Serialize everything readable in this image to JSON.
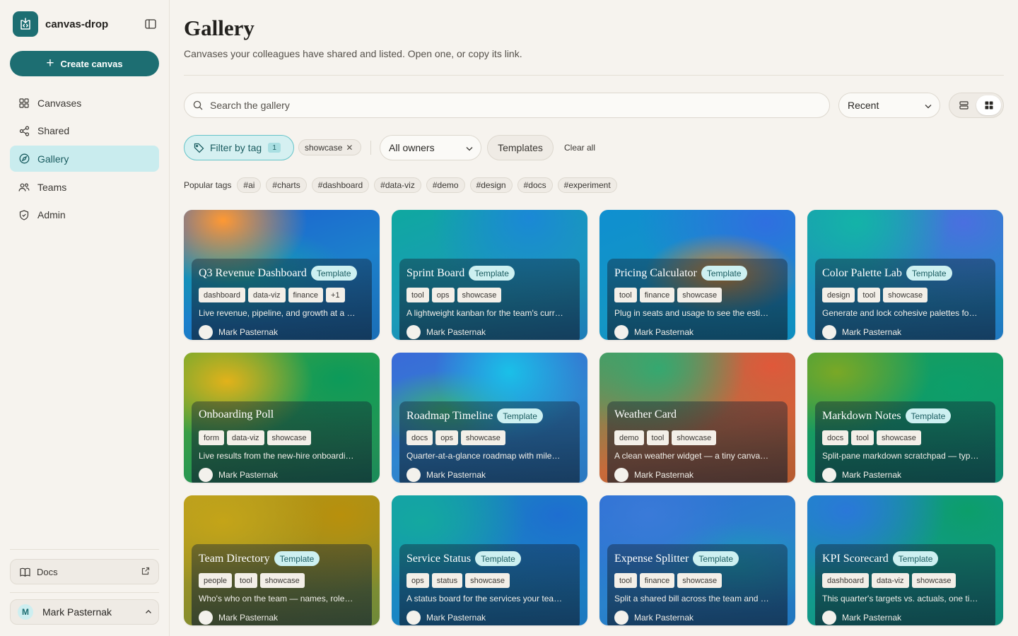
{
  "app": {
    "name": "canvas-drop"
  },
  "sidebar": {
    "create_label": "Create canvas",
    "items": [
      {
        "label": "Canvases",
        "icon": "grid-icon",
        "active": false
      },
      {
        "label": "Shared",
        "icon": "share-icon",
        "active": false
      },
      {
        "label": "Gallery",
        "icon": "compass-icon",
        "active": true
      },
      {
        "label": "Teams",
        "icon": "users-icon",
        "active": false
      },
      {
        "label": "Admin",
        "icon": "shield-icon",
        "active": false
      }
    ],
    "docs_label": "Docs",
    "user": {
      "initial": "M",
      "name": "Mark Pasternak"
    }
  },
  "page": {
    "title": "Gallery",
    "subtitle": "Canvases your colleagues have shared and listed. Open one, or copy its link."
  },
  "toolbar": {
    "search_placeholder": "Search the gallery",
    "sort_value": "Recent",
    "view_mode": "grid"
  },
  "filters": {
    "filter_by_tag_label": "Filter by tag",
    "filter_count": "1",
    "active_tag": "showcase",
    "owners_value": "All owners",
    "templates_label": "Templates",
    "clear_all_label": "Clear all"
  },
  "popular": {
    "label": "Popular tags",
    "tags": [
      "#ai",
      "#charts",
      "#dashboard",
      "#data-viz",
      "#demo",
      "#design",
      "#docs",
      "#experiment"
    ]
  },
  "colors": {
    "accent": "#1d6e72",
    "active_nav": "#c9ecee",
    "badge": "#cdf0f1"
  },
  "template_label": "Template",
  "cards": [
    {
      "title": "Q3 Revenue Dashboard",
      "template": true,
      "tags": [
        "dashboard",
        "data-viz",
        "finance",
        "+1"
      ],
      "desc": "Live revenue, pipeline, and growth at a glance for the quarter.",
      "owner": "Mark Pasternak",
      "bg": "radial-gradient(ellipse at 20% 8%, #ff9933 0%, rgba(255,153,51,0) 38%), radial-gradient(ellipse at 28% 50%, #11a8a8 0%, rgba(17,168,168,0) 55%), linear-gradient(160deg, #1d5fd0 0%, #1c80cc 55%, #1b6eb6 100%)"
    },
    {
      "title": "Sprint Board",
      "template": true,
      "tags": [
        "tool",
        "ops",
        "showcase"
      ],
      "desc": "A lightweight kanban for the team's current sprint.",
      "owner": "Mark Pasternak",
      "bg": "radial-gradient(ellipse at 70% 6%, #1b88d6 0%, rgba(27,136,214,0) 50%), linear-gradient(160deg, #0fa8a0 0%, #1a9bb8 55%, #1e7cb8 100%)"
    },
    {
      "title": "Pricing Calculator",
      "template": true,
      "tags": [
        "tool",
        "finance",
        "showcase"
      ],
      "desc": "Plug in seats and usage to see the estimated monthly cost.",
      "owner": "Mark Pasternak",
      "bg": "radial-gradient(ellipse at 62% 50%, #e0861e 0%, rgba(224,134,30,0) 45%), radial-gradient(ellipse at 85% 10%, #2f6fe0 0%, rgba(47,111,224,0) 55%), linear-gradient(160deg, #0f8fd0 0%, #1496c4 55%, #0f8ec0 100%)"
    },
    {
      "title": "Color Palette Lab",
      "template": true,
      "tags": [
        "design",
        "tool",
        "showcase"
      ],
      "desc": "Generate and lock cohesive palettes for your next project.",
      "owner": "Mark Pasternak",
      "bg": "radial-gradient(ellipse at 25% 10%, #14b3a8 0%, rgba(20,179,168,0) 45%), radial-gradient(ellipse at 80% 10%, #4a6fe0 0%, rgba(74,111,224,0) 50%), linear-gradient(160deg, #1a9cb0 0%, #1f8ec6 60%, #2078c0 100%)"
    },
    {
      "title": "Onboarding Poll",
      "template": false,
      "tags": [
        "form",
        "data-viz",
        "showcase"
      ],
      "desc": "Live results from the new-hire onboarding survey.",
      "owner": "Mark Pasternak",
      "bg": "radial-gradient(ellipse at 22% 22%, #e2b21a 0%, rgba(226,178,26,0) 40%), radial-gradient(ellipse at 80% 20%, #0c9a5a 0%, rgba(12,154,90,0) 55%), linear-gradient(160deg, #5aa832 0%, #2e9a4e 55%, #1a8a5a 100%)"
    },
    {
      "title": "Roadmap Timeline",
      "template": true,
      "tags": [
        "docs",
        "ops",
        "showcase"
      ],
      "desc": "Quarter-at-a-glance roadmap with milestones and owners.",
      "owner": "Mark Pasternak",
      "bg": "radial-gradient(ellipse at 60% 15%, #1ac0e8 0%, rgba(26,192,232,0) 45%), radial-gradient(ellipse at 28% 45%, #3ab070 0%, rgba(58,176,112,0) 40%), linear-gradient(160deg, #3a6ad8 0%, #2f86d0 55%, #2a78c0 100%)"
    },
    {
      "title": "Weather Card",
      "template": false,
      "tags": [
        "demo",
        "tool",
        "showcase"
      ],
      "desc": "A clean weather widget — a tiny canvas demo.",
      "owner": "Mark Pasternak",
      "bg": "radial-gradient(ellipse at 30% 12%, #35a870 0%, rgba(53,168,112,0) 45%), radial-gradient(ellipse at 88% 10%, #e0583a 0%, rgba(224,88,58,0) 50%), linear-gradient(160deg, #4d9a62 0%, #c86a3a 60%, #b65a30 100%)"
    },
    {
      "title": "Markdown Notes",
      "template": true,
      "tags": [
        "docs",
        "tool",
        "showcase"
      ],
      "desc": "Split-pane markdown scratchpad — type on the left, preview on the right.",
      "owner": "Mark Pasternak",
      "bg": "radial-gradient(ellipse at 15% 15%, #7aa826 0%, rgba(122,168,38,0) 40%), radial-gradient(ellipse at 75% 25%, #0c9e6a 0%, rgba(12,158,106,0) 55%), linear-gradient(160deg, #2a9e4a 0%, #11986a 55%, #0f8a72 100%)"
    },
    {
      "title": "Team Directory",
      "template": true,
      "tags": [
        "people",
        "tool",
        "showcase"
      ],
      "desc": "Who's who on the team — names, roles, and time zones.",
      "owner": "Mark Pasternak",
      "bg": "radial-gradient(ellipse at 20% 20%, #c4a418 0%, rgba(196,164,24,0) 45%), radial-gradient(ellipse at 80% 15%, #b8900c 0%, rgba(184,144,12,0) 50%), linear-gradient(160deg, #b89e20 0%, #8e8e2a 55%, #6e8a3a 100%)"
    },
    {
      "title": "Service Status",
      "template": true,
      "tags": [
        "ops",
        "status",
        "showcase"
      ],
      "desc": "A status board for the services your team owns.",
      "owner": "Mark Pasternak",
      "bg": "radial-gradient(ellipse at 15% 20%, #14a8a0 0%, rgba(20,168,160,0) 45%), radial-gradient(ellipse at 85% 15%, #1e6ed0 0%, rgba(30,110,208,0) 55%), linear-gradient(160deg, #129ea8 0%, #1a88c4 55%, #1c78c0 100%)"
    },
    {
      "title": "Expense Splitter",
      "template": true,
      "tags": [
        "tool",
        "finance",
        "showcase"
      ],
      "desc": "Split a shared bill across the team and settle up fast.",
      "owner": "Mark Pasternak",
      "bg": "radial-gradient(ellipse at 25% 15%, #3a7ad8 0%, rgba(58,122,216,0) 45%), radial-gradient(ellipse at 70% 55%, #1a9ab8 0%, rgba(26,154,184,0) 45%), linear-gradient(160deg, #2d6fd4 0%, #2a82cc 55%, #2076be 100%)"
    },
    {
      "title": "KPI Scorecard",
      "template": true,
      "tags": [
        "dashboard",
        "data-viz",
        "showcase"
      ],
      "desc": "This quarter's targets vs. actuals, one tile per metric.",
      "owner": "Mark Pasternak",
      "bg": "radial-gradient(ellipse at 20% 12%, #2a78d8 0%, rgba(42,120,216,0) 45%), radial-gradient(ellipse at 82% 12%, #0c9e6a 0%, rgba(12,158,106,0) 55%), linear-gradient(160deg, #1a8ec4 0%, #129a8a 55%, #0f8e7a 100%)"
    }
  ]
}
